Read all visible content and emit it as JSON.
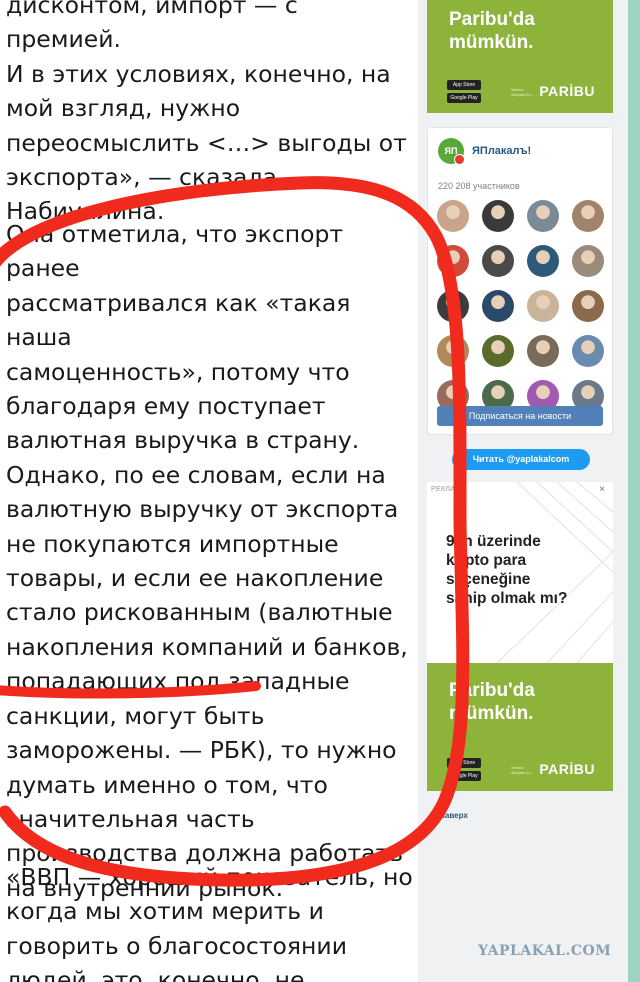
{
  "article": {
    "paragraph1": "дисконтом, импорт — с премией.\nИ в этих условиях, конечно, на\nмой взгляд, нужно\nпереосмыслить <…> выгоды от\nэкспорта», — сказала\nНабиуллина.",
    "paragraph2": "Она отметила, что экспорт ранее\nрассматривался как «такая наша\nсамоценность», потому что\nблагодаря ему поступает\nвалютная выручка в страну.\nОднако, по ее словам, если на\nвалютную выручку от экспорта\nне покупаются импортные\nтовары, и если ее накопление\nстало рискованным (валютные\nнакопления компаний и банков,\nпопадающих под западные\nсанкции, могут быть\nзаморожены. — РБК), то нужно\nдумать именно о том, что\nзначительная часть\nпроизводства должна работать\nна внутренний рынок.",
    "paragraph3": "«ВВП — хороший показатель, но\nкогда мы хотим мерить и\nговорить о благосостоянии\nлюдей, это, конечно, не"
  },
  "ad_top": {
    "headline": "Paribu'da\nmümkün.",
    "badge_appstore": "App Store",
    "badge_google": "Google Play",
    "small_text": "Yatırım\ndünyası\nbu...",
    "brand": "PARİBU"
  },
  "vk_widget": {
    "logo": "ЯП",
    "group_name": "ЯПлакалъ!",
    "members": "220 208 участников",
    "subscribe_label": "Подписаться на новости",
    "avatar_colors": [
      "#c9a38a",
      "#3a3a3a",
      "#7a8a96",
      "#a0836a",
      "#d24a3c",
      "#4a4a4a",
      "#2e5a7a",
      "#9a8a7a",
      "#3c3c3c",
      "#2a4a6a",
      "#c9b49a",
      "#8a6a4a",
      "#b08a5a",
      "#5a6a2a",
      "#7a6a5a",
      "#6a8ab0",
      "#9a6a5a",
      "#4a6a4a",
      "#a05ab0",
      "#6a7a8a"
    ]
  },
  "twitter_button": "Читать @yaplakalcom",
  "ad_mid": {
    "label": "РЕКЛАМА",
    "close": "×",
    "text": "9 ın üzerinde\nkripto para\nseçeneğine\nsahip olmak mı?"
  },
  "ad_bottom": {
    "headline": "Paribu'da\nmümkün.",
    "badge_appstore": "App Store",
    "badge_google": "Google Play",
    "small_text": "Yatırım\ndünyası\nbu...",
    "brand": "PARİBU"
  },
  "back_link": "▲ Наверх",
  "watermark": "YAPLAKAL.COM",
  "colors": {
    "ad_green": "#8db33b",
    "vk_blue": "#5181b8",
    "twitter_blue": "#1d9bf0",
    "scribble_red": "#f02a1c"
  }
}
